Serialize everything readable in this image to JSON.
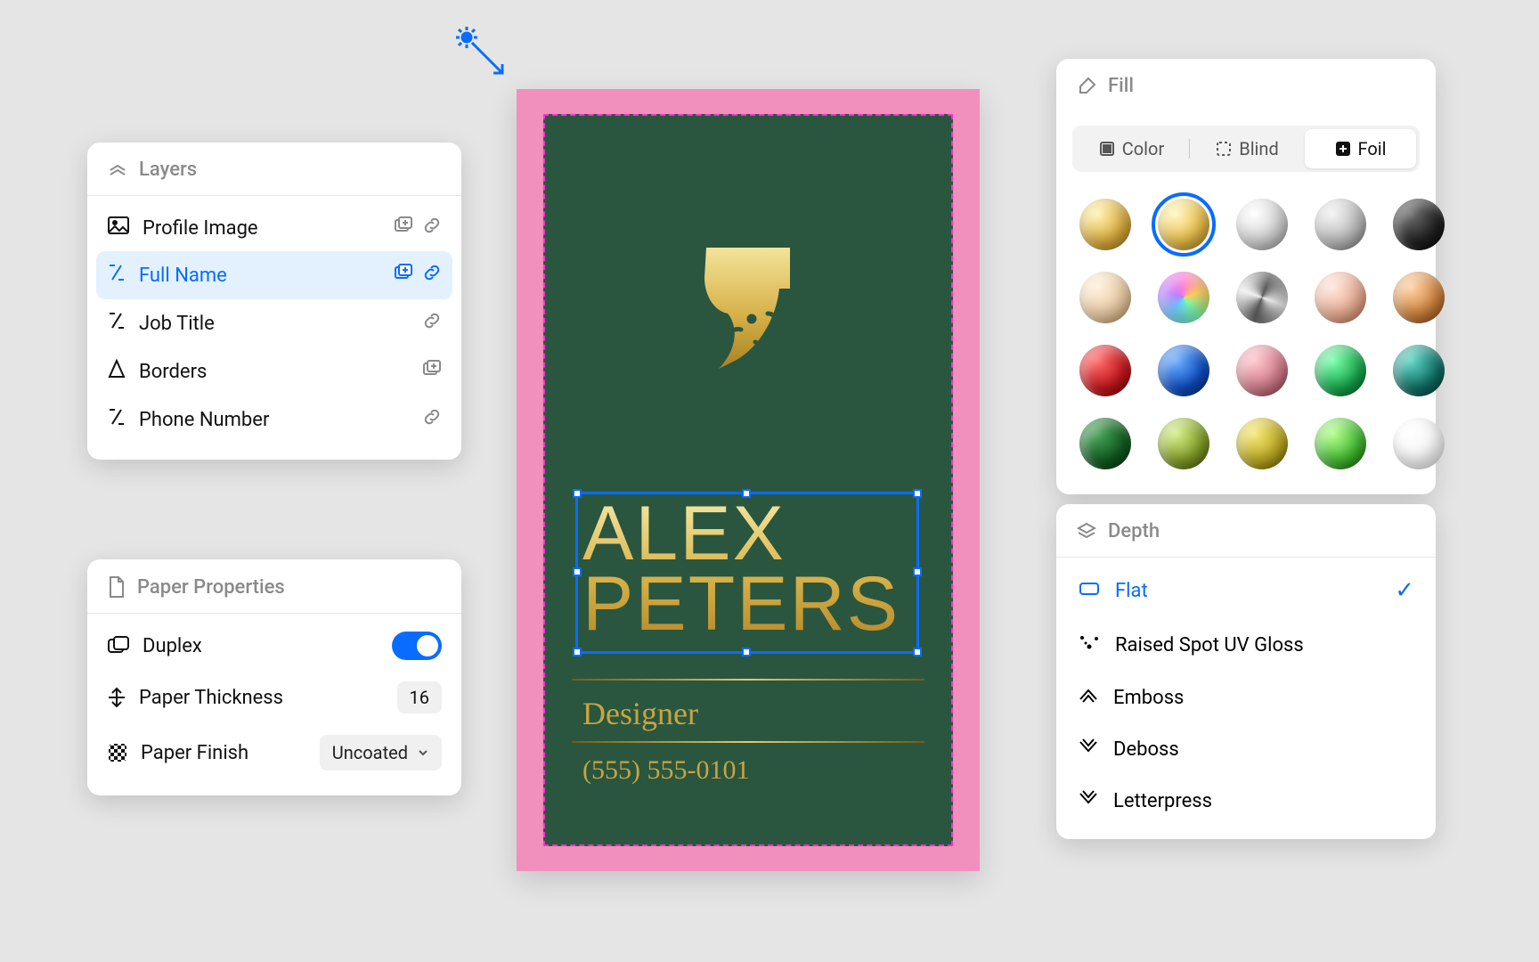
{
  "layers": {
    "title": "Layers",
    "items": [
      {
        "label": "Profile Image",
        "icon": "image",
        "add": true,
        "link": true,
        "selected": false
      },
      {
        "label": "Full Name",
        "icon": "text",
        "add": true,
        "link": true,
        "selected": true
      },
      {
        "label": "Job Title",
        "icon": "text",
        "add": false,
        "link": true,
        "selected": false
      },
      {
        "label": "Borders",
        "icon": "shape",
        "add": true,
        "link": false,
        "selected": false
      },
      {
        "label": "Phone Number",
        "icon": "text",
        "add": false,
        "link": true,
        "selected": false
      }
    ]
  },
  "paper": {
    "title": "Paper Properties",
    "duplex_label": "Duplex",
    "duplex_on": true,
    "thickness_label": "Paper Thickness",
    "thickness_value": "16",
    "finish_label": "Paper Finish",
    "finish_value": "Uncoated"
  },
  "card": {
    "name": "ALEX\nPETERS",
    "job": "Designer",
    "phone": "(555) 555-0101"
  },
  "fill": {
    "title": "Fill",
    "tabs": {
      "color": "Color",
      "blind": "Blind",
      "foil": "Foil",
      "active": "foil"
    },
    "swatches": [
      {
        "name": "gold-matte",
        "css": "radial-gradient(circle at 35% 30%, #fff3b0, #d9a93a 60%, #9b7418)"
      },
      {
        "name": "gold-shiny",
        "css": "radial-gradient(circle at 35% 30%, #fff7c0, #e9c04d 55%, #a97c18)",
        "selected": true
      },
      {
        "name": "silver-light",
        "css": "radial-gradient(circle at 35% 30%, #ffffff, #cfcfcf 60%, #8d8d8d)"
      },
      {
        "name": "silver",
        "css": "radial-gradient(circle at 35% 30%, #f2f2f2, #b8b8b8 60%, #6f6f6f)"
      },
      {
        "name": "black",
        "css": "radial-gradient(circle at 35% 30%, #6b6b6b, #1e1e1e 60%, #000)"
      },
      {
        "name": "champagne",
        "css": "radial-gradient(circle at 35% 30%, #fff0dc, #e8c9a0 60%, #b88a54)"
      },
      {
        "name": "holographic",
        "css": "conic-gradient(from 0deg, #ff7bd7,#ffd25a,#7bffb0,#6cc9ff,#c07bff,#ff7bd7)"
      },
      {
        "name": "steel",
        "css": "conic-gradient(from 200deg at 50% 50%, #5a5a5a,#f0f0f0,#5a5a5a,#f0f0f0,#5a5a5a)"
      },
      {
        "name": "rose-gold",
        "css": "radial-gradient(circle at 35% 30%, #ffe6de, #e8a98d 60%, #b56a4a)"
      },
      {
        "name": "copper",
        "css": "radial-gradient(circle at 35% 30%, #ffd3a6, #cc7f3a 60%, #7b3e0c)"
      },
      {
        "name": "red",
        "css": "radial-gradient(circle at 35% 30%, #ff6b6b, #c3151a 60%, #6e0006)"
      },
      {
        "name": "blue",
        "css": "radial-gradient(circle at 35% 30%, #6fb0ff, #0b4cc2 60%, #052561)"
      },
      {
        "name": "rose",
        "css": "radial-gradient(circle at 35% 30%, #ffc7cf, #d07a88 60%, #7a3944)"
      },
      {
        "name": "green",
        "css": "radial-gradient(circle at 35% 30%, #7dffb0, #15a84a 60%, #065123)"
      },
      {
        "name": "teal",
        "css": "radial-gradient(circle at 35% 30%, #5fd6c6, #0f6e65 60%, #053530)"
      },
      {
        "name": "dark-green",
        "css": "radial-gradient(circle at 35% 30%, #49a35a, #0f5a1e 60%, #042c0c)"
      },
      {
        "name": "olive",
        "css": "radial-gradient(circle at 35% 30%, #d6f08a, #7e9a22 60%, #3f4e05)"
      },
      {
        "name": "mustard",
        "css": "radial-gradient(circle at 35% 30%, #f6e978, #b9a61e 60%, #5c5104)"
      },
      {
        "name": "lime",
        "css": "radial-gradient(circle at 35% 30%, #b6ff8f, #3fb82e 60%, #155908)"
      },
      {
        "name": "white",
        "css": "radial-gradient(circle at 35% 30%, #ffffff, #f2f2f2 70%, #dcdcdc)"
      }
    ]
  },
  "depth": {
    "title": "Depth",
    "options": [
      {
        "label": "Flat",
        "icon": "flat",
        "selected": true
      },
      {
        "label": "Raised Spot UV Gloss",
        "icon": "sparkle",
        "selected": false
      },
      {
        "label": "Emboss",
        "icon": "up",
        "selected": false
      },
      {
        "label": "Deboss",
        "icon": "down",
        "selected": false
      },
      {
        "label": "Letterpress",
        "icon": "down",
        "selected": false
      }
    ]
  }
}
